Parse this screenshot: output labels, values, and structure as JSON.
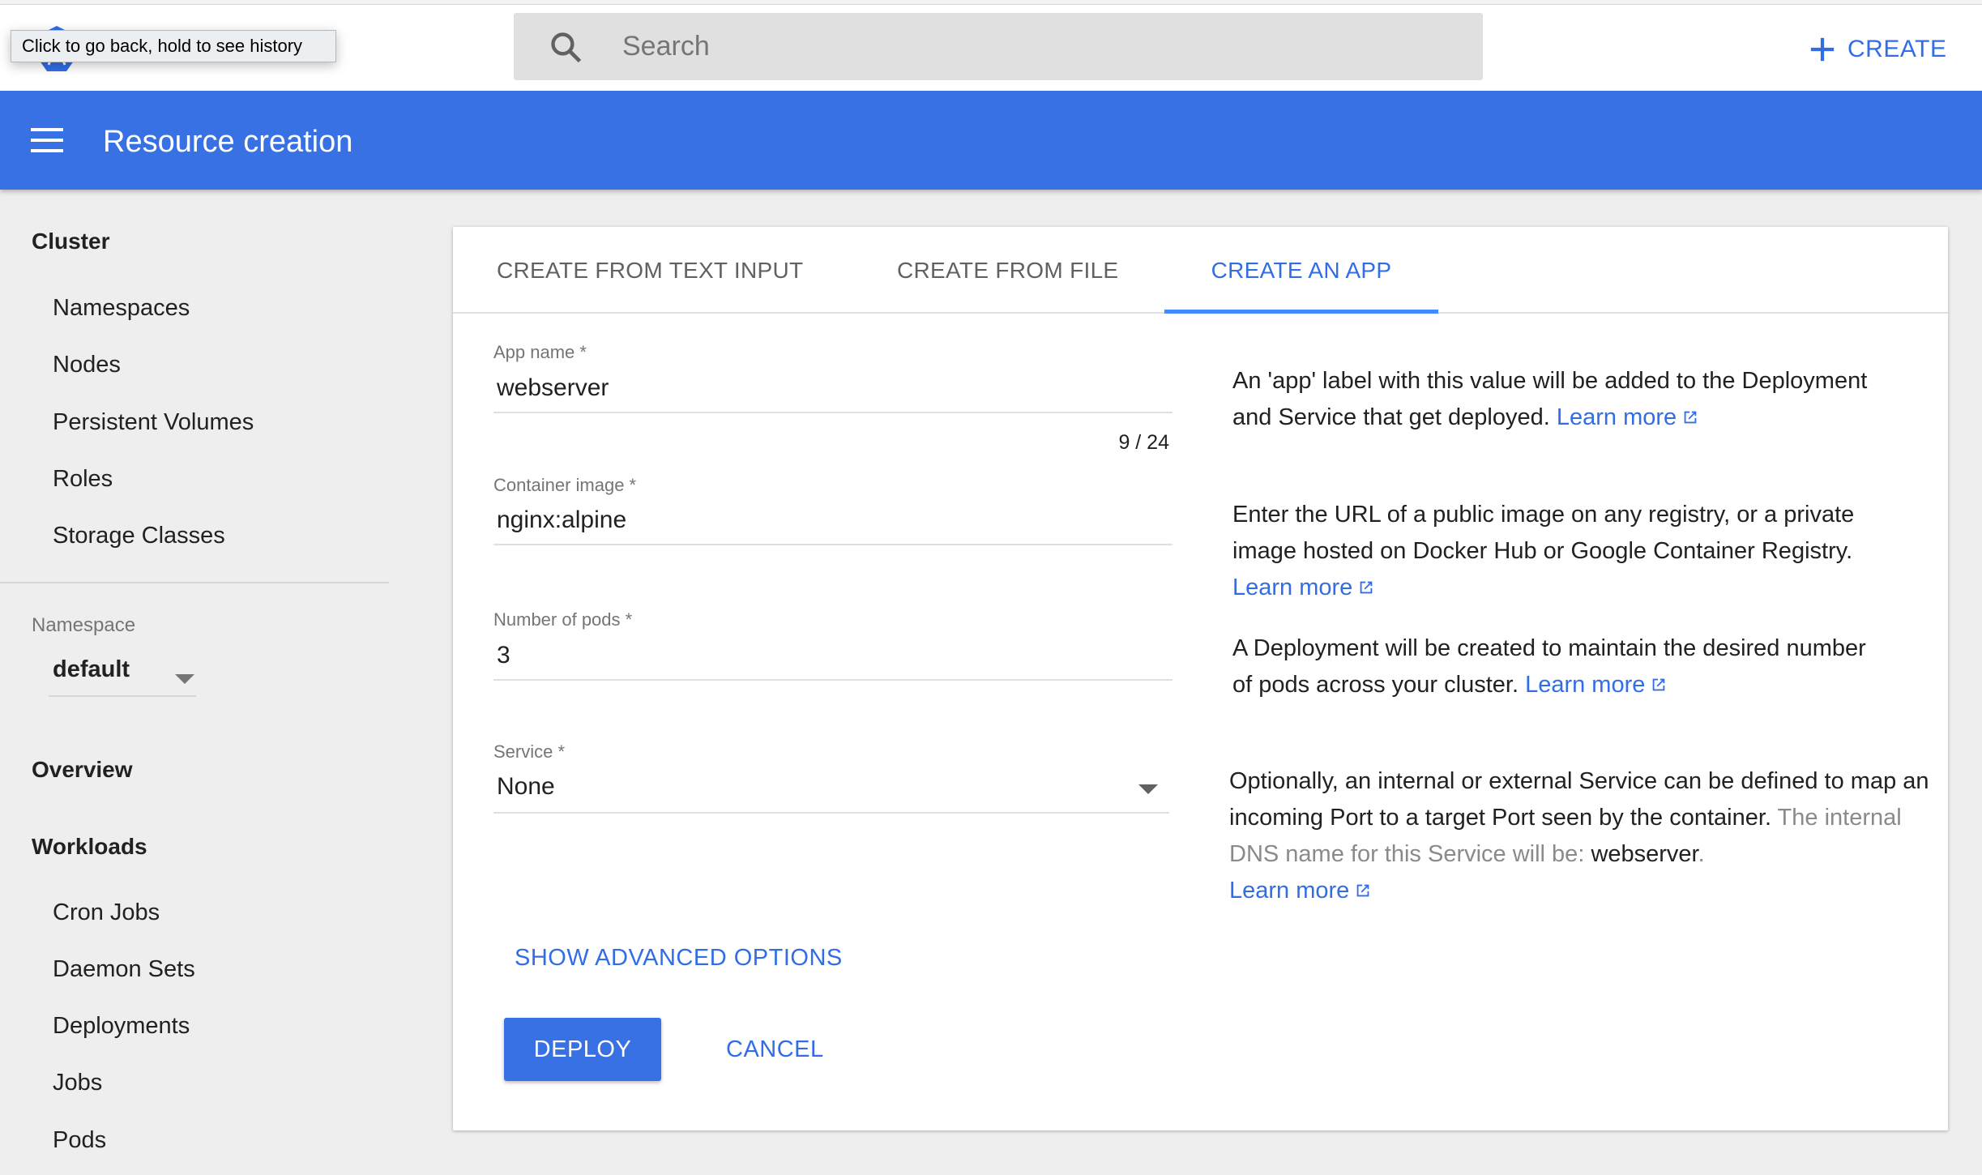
{
  "browser": {
    "back_tooltip": "Click to go back, hold to see history"
  },
  "toolbar": {
    "logo_icon": "kubernetes-logo-icon",
    "search": {
      "placeholder": "Search",
      "value": "",
      "icon": "search-icon"
    },
    "create_label": "CREATE",
    "create_icon": "plus-icon"
  },
  "appbar": {
    "menu_icon": "hamburger-menu-icon",
    "title": "Resource creation"
  },
  "colors": {
    "brand_blue": "#3771e3",
    "link_blue": "#326de6",
    "tab_ink": "#448aff",
    "sidebar_bg": "#eeeeee"
  },
  "sidebar": {
    "cluster": {
      "heading": "Cluster",
      "items": [
        {
          "label": "Namespaces"
        },
        {
          "label": "Nodes"
        },
        {
          "label": "Persistent Volumes"
        },
        {
          "label": "Roles"
        },
        {
          "label": "Storage Classes"
        }
      ]
    },
    "namespace": {
      "label": "Namespace",
      "selected": "default"
    },
    "overview": {
      "heading": "Overview"
    },
    "workloads": {
      "heading": "Workloads",
      "items": [
        {
          "label": "Cron Jobs"
        },
        {
          "label": "Daemon Sets"
        },
        {
          "label": "Deployments"
        },
        {
          "label": "Jobs"
        },
        {
          "label": "Pods"
        }
      ]
    }
  },
  "main": {
    "tabs": [
      {
        "label": "CREATE FROM TEXT INPUT",
        "active": false
      },
      {
        "label": "CREATE FROM FILE",
        "active": false
      },
      {
        "label": "CREATE AN APP",
        "active": true
      }
    ],
    "form": {
      "app_name": {
        "label": "App name *",
        "value": "webserver",
        "counter": "9 / 24"
      },
      "container_image": {
        "label": "Container image *",
        "value": "nginx:alpine"
      },
      "pods": {
        "label": "Number of pods *",
        "value": "3"
      },
      "service": {
        "label": "Service *",
        "selected": "None"
      }
    },
    "help": {
      "app_name": {
        "text": "An 'app' label with this value will be added to the Deployment and Service that get deployed.",
        "link": "Learn more"
      },
      "container_image": {
        "text": "Enter the URL of a public image on any registry, or a private image hosted on Docker Hub or Google Container Registry.",
        "link": "Learn more"
      },
      "pods": {
        "text": "A Deployment will be created to maintain the desired number of pods across your cluster.",
        "link": "Learn more"
      },
      "service": {
        "text": "Optionally, an internal or external Service can be defined to map an incoming Port to a target Port seen by the container.",
        "dns_prefix": "The internal DNS name for this Service will be:",
        "dns_name": "webserver",
        "dns_suffix": ".",
        "link": "Learn more"
      }
    },
    "actions": {
      "advanced": "SHOW ADVANCED OPTIONS",
      "deploy": "DEPLOY",
      "cancel": "CANCEL"
    }
  }
}
